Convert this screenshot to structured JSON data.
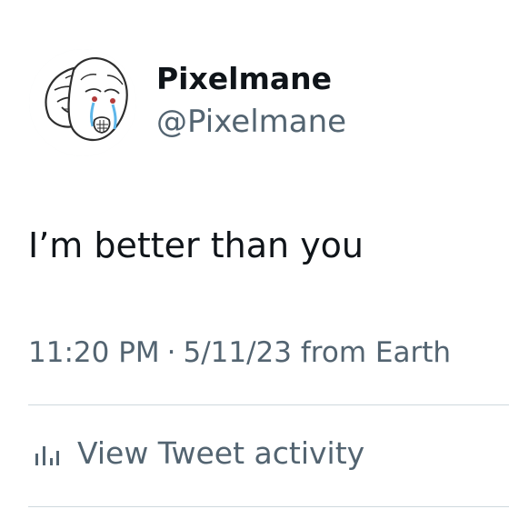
{
  "tweet": {
    "display_name": "Pixelmane",
    "handle": "@Pixelmane",
    "text": "I’m better than you",
    "time": "11:20 PM",
    "separator": "·",
    "date": "5/11/23",
    "source": "from Earth",
    "activity_label": "View Tweet activity",
    "avatar_icon": "wojak-mask-avatar-icon",
    "activity_icon": "bar-chart-icon",
    "colors": {
      "primary_text": "#0f1419",
      "secondary_text": "#536471",
      "divider": "#cfd9de"
    }
  }
}
